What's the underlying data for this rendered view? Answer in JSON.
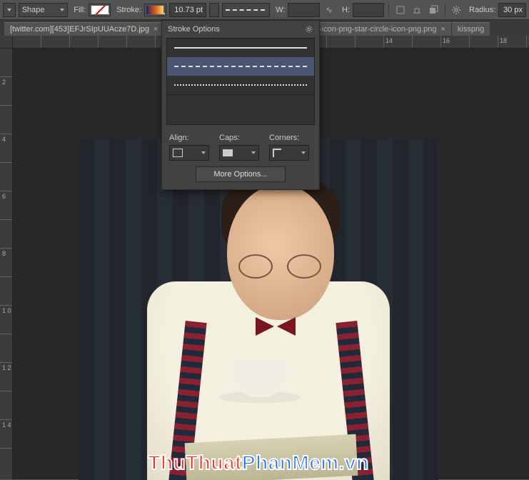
{
  "options_bar": {
    "tool_mode": "Shape",
    "fill_label": "Fill:",
    "stroke_label": "Stroke:",
    "stroke_weight": "10.73 pt",
    "w_label": "W:",
    "h_label": "H:",
    "radius_label": "Radius:",
    "radius_value": "30 px",
    "fill_value": "no-fill",
    "stroke_value": "gradient",
    "stroke_style": "dashed"
  },
  "tabs": [
    {
      "label": "[twitter.com][453]EFJrSIpUUAcze7D.jpg",
      "active": true
    },
    {
      "label": "el-icon-png-star-circle-icon-png.png",
      "active": false
    },
    {
      "label": "kisspng",
      "active": false
    }
  ],
  "ruler_h": [
    "",
    "",
    "",
    "",
    "",
    "",
    "",
    "",
    "",
    "",
    "",
    "",
    "",
    "14",
    "",
    "16",
    "",
    "18"
  ],
  "ruler_v": [
    "",
    "2",
    "",
    "4",
    "",
    "6",
    "",
    "8",
    "",
    "1\n0",
    "",
    "1\n2",
    "",
    "1\n4"
  ],
  "popover": {
    "title": "Stroke Options",
    "stroke_styles": [
      "solid",
      "dashed",
      "dotted"
    ],
    "selected_index": 1,
    "align_label": "Align:",
    "caps_label": "Caps:",
    "corners_label": "Corners:",
    "more_button": "More Options..."
  },
  "watermark": {
    "part1": "ThuThuat",
    "part2": "PhanMem",
    "part3": ".vn"
  },
  "colors": {
    "ui_bg": "#535353",
    "canvas_bg": "#282828",
    "selection": "#4a5672",
    "accent_red": "#ff2020",
    "accent_blue": "#1a6bff"
  }
}
